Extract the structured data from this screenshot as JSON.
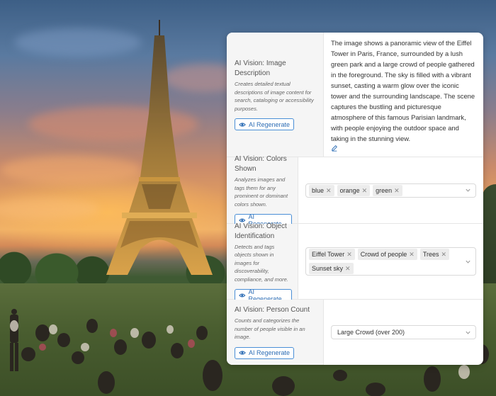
{
  "regenerate_label": "AI Regenerate",
  "fields": [
    {
      "title": "AI Vision: Image Description",
      "description": "Creates detailed textual descriptions of image content for search, cataloging or accessibility purposes.",
      "value": "The image shows a panoramic view of the Eiffel Tower in Paris, France, surrounded by a lush green park and a large crowd of people gathered in the foreground. The sky is filled with a vibrant sunset, casting a warm glow over the iconic tower and the surrounding landscape. The scene captures the bustling and picturesque atmosphere of this famous Parisian landmark, with people enjoying the outdoor space and taking in the stunning view."
    },
    {
      "title": "AI Vision: Colors Shown",
      "description": "Analyzes images and tags them for any prominent or dominant colors shown.",
      "tags": [
        "blue",
        "orange",
        "green"
      ]
    },
    {
      "title": "AI Vision: Object Identification",
      "description": "Detects and tags objects shown in images for discoverability, compliance, and more.",
      "tags": [
        "Eiffel Tower",
        "Crowd of people",
        "Trees",
        "Sunset sky"
      ]
    },
    {
      "title": "AI Vision: Person Count",
      "description": "Counts and categorizes the number of people visible in an image.",
      "selected": "Large Crowd (over 200)"
    }
  ],
  "colors": {
    "accent": "#2d6db5",
    "accent_border": "#4a8fd6"
  }
}
